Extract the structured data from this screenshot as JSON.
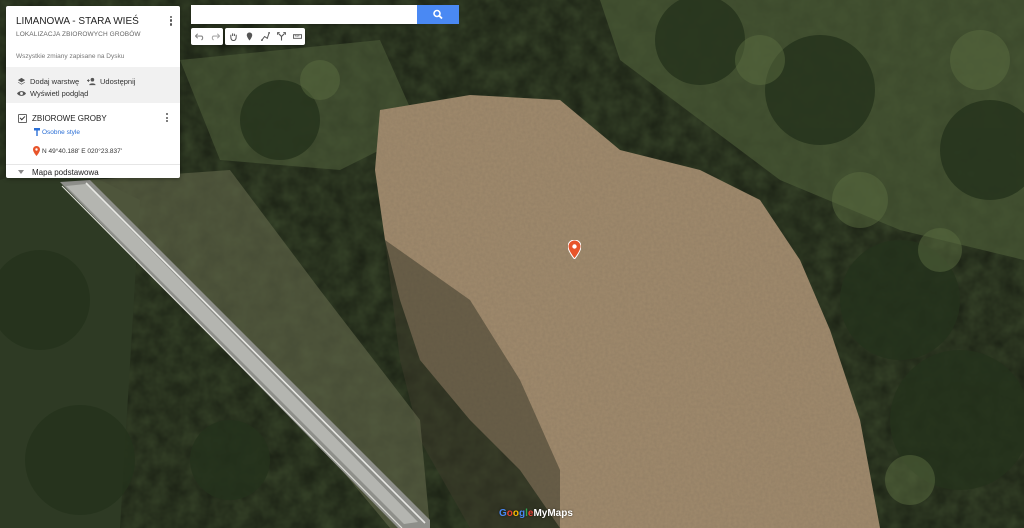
{
  "map": {
    "title": "LIMANOWA - STARA WIEŚ",
    "subtitle": "LOKALIZACJA ZBIOROWYCH GROBÓW",
    "saved_status": "Wszystkie zmiany zapisane na Dysku",
    "actions": {
      "add_layer": "Dodaj warstwę",
      "share": "Udostępnij",
      "preview": "Wyświetl podgląd"
    },
    "layer": {
      "name": "ZBIOROWE GROBY",
      "style": "Osobne style",
      "place": "N 49°40.188' E 020°23.837'"
    },
    "base_map": "Mapa podstawowa"
  },
  "search": {
    "value": "",
    "button_icon": "search-icon"
  },
  "toolbar": {
    "icons": [
      "undo-icon",
      "redo-icon",
      "hand-icon",
      "marker-icon",
      "draw-line-icon",
      "directions-icon",
      "measure-icon"
    ]
  },
  "branding": {
    "logo": "Google My Maps"
  },
  "colors": {
    "accent": "#4a89f3",
    "marker": "#e8542a",
    "link": "#2b6fd6"
  }
}
